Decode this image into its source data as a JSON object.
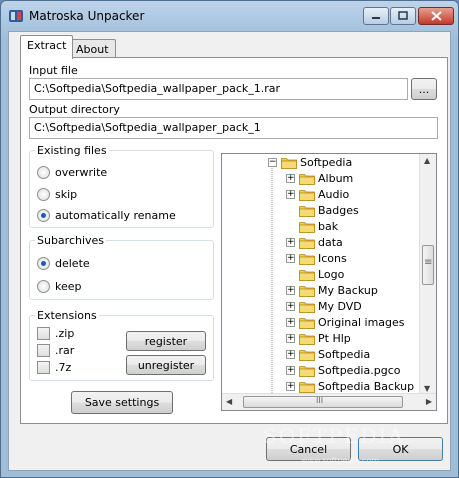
{
  "window": {
    "title": "Matroska Unpacker"
  },
  "tabs": [
    {
      "label": "Extract",
      "active": true
    },
    {
      "label": "About",
      "active": false
    }
  ],
  "input": {
    "label": "Input file",
    "value": "C:\\Softpedia\\Softpedia_wallpaper_pack_1.rar",
    "browse_label": "..."
  },
  "output": {
    "label": "Output directory",
    "value": "C:\\Softpedia\\Softpedia_wallpaper_pack_1"
  },
  "existing_files": {
    "title": "Existing files",
    "options": [
      {
        "label": "overwrite",
        "selected": false
      },
      {
        "label": "skip",
        "selected": false
      },
      {
        "label": "automatically rename",
        "selected": true
      }
    ]
  },
  "subarchives": {
    "title": "Subarchives",
    "options": [
      {
        "label": "delete",
        "selected": true
      },
      {
        "label": "keep",
        "selected": false
      }
    ]
  },
  "extensions": {
    "title": "Extensions",
    "items": [
      {
        "label": ".zip",
        "checked": false
      },
      {
        "label": ".rar",
        "checked": false
      },
      {
        "label": ".7z",
        "checked": false
      }
    ],
    "register_label": "register",
    "unregister_label": "unregister"
  },
  "save_settings_label": "Save settings",
  "tree": {
    "root": "Softpedia",
    "items": [
      {
        "label": "Album",
        "expandable": true
      },
      {
        "label": "Audio",
        "expandable": true
      },
      {
        "label": "Badges",
        "expandable": false
      },
      {
        "label": "bak",
        "expandable": false
      },
      {
        "label": "data",
        "expandable": true
      },
      {
        "label": "Icons",
        "expandable": true
      },
      {
        "label": "Logo",
        "expandable": false
      },
      {
        "label": "My Backup",
        "expandable": true
      },
      {
        "label": "My DVD",
        "expandable": true
      },
      {
        "label": "Original images",
        "expandable": true
      },
      {
        "label": "Pt Hlp",
        "expandable": true
      },
      {
        "label": "Softpedia",
        "expandable": true
      },
      {
        "label": "Softpedia.pgco",
        "expandable": true
      },
      {
        "label": "Softpedia Backup",
        "expandable": true
      }
    ],
    "vscroll_thumb_glyph": "≡",
    "hscroll_thumb_glyph": "III"
  },
  "footer": {
    "cancel_label": "Cancel",
    "ok_label": "OK"
  },
  "watermark": {
    "text": "SOFTPEDIA",
    "url": "www.softpedia.com"
  },
  "colors": {
    "folder": "#f3c75a",
    "accent": "#1e5cb3",
    "close_button": "#c0392b"
  }
}
